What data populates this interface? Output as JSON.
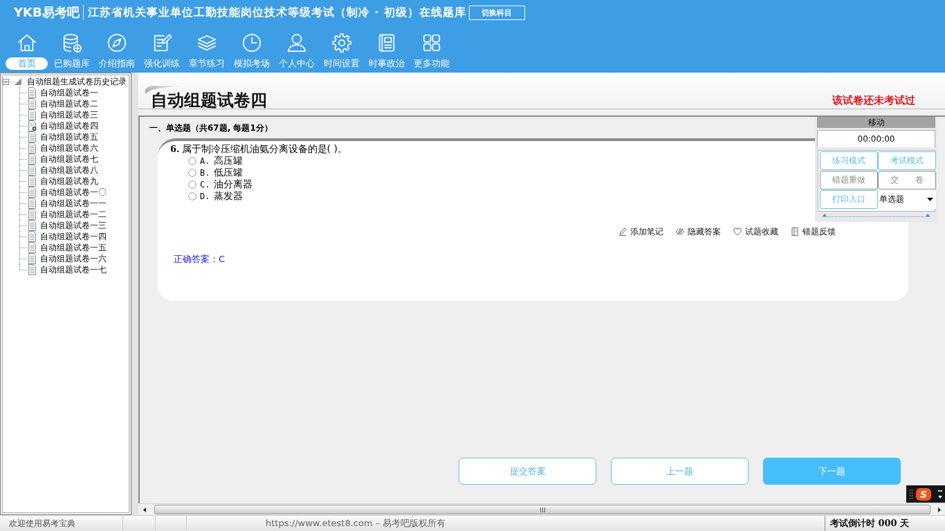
{
  "header": {
    "logo": "YKB易考吧",
    "title": "江苏省机关事业单位工勤技能岗位技术等级考试（制冷 · 初级）在线题库",
    "switch_button": "切换科目"
  },
  "nav": [
    {
      "kind": "home",
      "label": "首页",
      "selected": true
    },
    {
      "kind": "database",
      "label": "已购题库",
      "selected": false
    },
    {
      "kind": "compass",
      "label": "介绍指南",
      "selected": false
    },
    {
      "kind": "edit",
      "label": "强化训练",
      "selected": false
    },
    {
      "kind": "layers",
      "label": "章节练习",
      "selected": false
    },
    {
      "kind": "clock",
      "label": "模拟考场",
      "selected": false
    },
    {
      "kind": "user",
      "label": "个人中心",
      "selected": false
    },
    {
      "kind": "gear",
      "label": "时间设置",
      "selected": false
    },
    {
      "kind": "news",
      "label": "时事政治",
      "selected": false
    },
    {
      "kind": "grid",
      "label": "更多功能",
      "selected": false
    }
  ],
  "sidebar": {
    "tree": [
      {
        "label": "自动组题生成试卷历史记录",
        "expanded": true,
        "children": [
          {
            "label": "自动组题试卷一",
            "kind": "paper"
          },
          {
            "label": "自动组题试卷二",
            "kind": "paper"
          },
          {
            "label": "自动组题试卷三",
            "kind": "paper"
          },
          {
            "label": "自动组题试卷四",
            "kind": "current"
          },
          {
            "label": "自动组题试卷五",
            "kind": "paper"
          },
          {
            "label": "自动组题试卷六",
            "kind": "paper"
          },
          {
            "label": "自动组题试卷七",
            "kind": "paper"
          },
          {
            "label": "自动组题试卷八",
            "kind": "paper"
          },
          {
            "label": "自动组题试卷九",
            "kind": "paper"
          },
          {
            "label": "自动组题试卷一〇",
            "kind": "paper"
          },
          {
            "label": "自动组题试卷一一",
            "kind": "paper"
          },
          {
            "label": "自动组题试卷一二",
            "kind": "paper"
          },
          {
            "label": "自动组题试卷一三",
            "kind": "paper"
          },
          {
            "label": "自动组题试卷一四",
            "kind": "paper"
          },
          {
            "label": "自动组题试卷一五",
            "kind": "paper"
          },
          {
            "label": "自动组题试卷一六",
            "kind": "paper"
          },
          {
            "label": "自动组题试卷一七",
            "kind": "paper"
          }
        ]
      }
    ]
  },
  "paper": {
    "title": "自动组题试卷四",
    "status": "该试卷还未考试过"
  },
  "section": {
    "heading": "一、单选题（共67题, 每题1分）"
  },
  "question": {
    "number": "6.",
    "text": "属于制冷压缩机油氨分离设备的是( )。",
    "options": [
      {
        "letter": "A.",
        "text": "高压罐",
        "selected": false
      },
      {
        "letter": "B.",
        "text": "低压罐",
        "selected": false
      },
      {
        "letter": "C.",
        "text": "油分离器",
        "selected": false
      },
      {
        "letter": "D.",
        "text": "蒸发器",
        "selected": false
      }
    ],
    "tools": [
      {
        "kind": "note",
        "label": "添加笔记"
      },
      {
        "kind": "hide",
        "label": "隐藏答案"
      },
      {
        "kind": "favorite",
        "label": "试题收藏"
      },
      {
        "kind": "feedback",
        "label": "错题反馈"
      }
    ],
    "answer": "正确答案：C"
  },
  "panel": {
    "header": "移动",
    "timer": "00:00:00",
    "buttons": [
      {
        "label": "练习模式",
        "disabled": false
      },
      {
        "label": "考试模式",
        "disabled": false
      },
      {
        "label": "错题重做",
        "disabled": true
      },
      {
        "label": "交　　卷",
        "disabled": true
      },
      {
        "label": "打印入口",
        "disabled": false
      }
    ],
    "select": {
      "value": "单选题"
    }
  },
  "pager": [
    {
      "label": "提交答案",
      "kind": "outline"
    },
    {
      "label": "上一题",
      "kind": "outline"
    },
    {
      "label": "下一题",
      "kind": "primary"
    }
  ],
  "ime_toolbar": {
    "logo": "S"
  },
  "status_bar": {
    "left": "欢迎使用易考宝典",
    "center": "https://www.etest8.com – 易考吧版权所有",
    "right": "考试倒计时 000 天"
  }
}
